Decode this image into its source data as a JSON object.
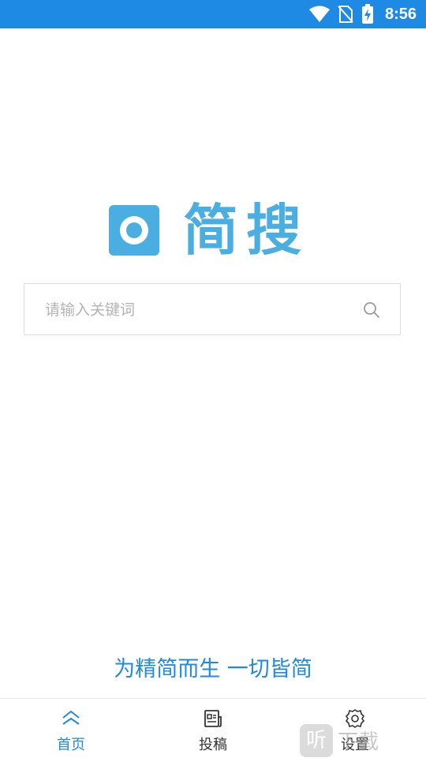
{
  "status_bar": {
    "time": "8:56",
    "icons": [
      "wifi-icon",
      "no-sim-icon",
      "battery-charging-icon"
    ]
  },
  "logo": {
    "text": "简搜"
  },
  "search": {
    "placeholder": "请输入关键词",
    "value": "",
    "icon": "search-icon"
  },
  "slogan": "为精简而生 一切皆简",
  "tabbar": {
    "accent_color": "#1f8ae3",
    "items": [
      {
        "label": "首页",
        "icon": "home-icon",
        "active": true
      },
      {
        "label": "投稿",
        "icon": "document-icon",
        "active": false
      },
      {
        "label": "设置",
        "icon": "gear-icon",
        "active": false
      }
    ]
  },
  "watermark": {
    "badge": "听",
    "text": "下载"
  }
}
